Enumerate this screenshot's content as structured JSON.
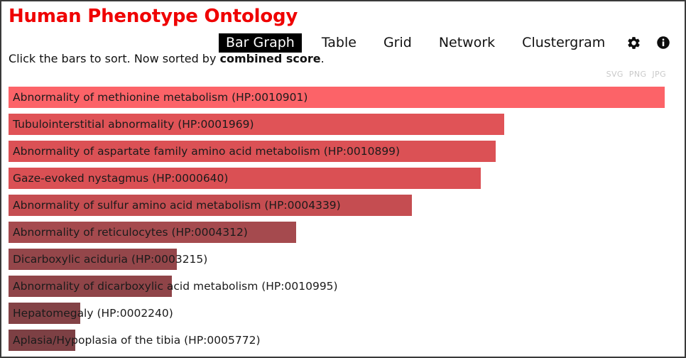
{
  "header": {
    "title": "Human Phenotype Ontology",
    "title_color": "#ef0000",
    "subtitle_pre": "Click the bars to sort. Now sorted by ",
    "subtitle_bold": "combined score",
    "subtitle_post": "."
  },
  "tabs": [
    {
      "label": "Bar Graph",
      "active": true
    },
    {
      "label": "Table",
      "active": false
    },
    {
      "label": "Grid",
      "active": false
    },
    {
      "label": "Network",
      "active": false
    },
    {
      "label": "Clustergram",
      "active": false
    }
  ],
  "header_icons": [
    {
      "name": "gear-icon",
      "label": "Settings"
    },
    {
      "name": "info-icon",
      "label": "Info"
    }
  ],
  "exports": [
    "SVG",
    "PNG",
    "JPG"
  ],
  "chart_data": {
    "type": "bar",
    "orientation": "horizontal",
    "title": "Human Phenotype Ontology",
    "xlabel": "",
    "ylabel": "",
    "sorted_by": "combined score",
    "grid": false,
    "legend": false,
    "xlim": [
      0,
      100
    ],
    "categories": [
      "Abnormality of methionine metabolism (HP:0010901)",
      "Tubulointerstitial abnormality (HP:0001969)",
      "Abnormality of aspartate family amino acid metabolism (HP:0010899)",
      "Gaze-evoked nystagmus (HP:0000640)",
      "Abnormality of sulfur amino acid metabolism (HP:0004339)",
      "Abnormality of reticulocytes (HP:0004312)",
      "Dicarboxylic aciduria (HP:0003215)",
      "Abnormality of dicarboxylic acid metabolism (HP:0010995)",
      "Hepatomegaly (HP:0002240)",
      "Aplasia/Hypoplasia of the tibia (HP:0005772)"
    ],
    "values": [
      100.0,
      75.5,
      74.2,
      72.0,
      61.5,
      43.8,
      25.6,
      24.9,
      10.9,
      10.2
    ],
    "bar_colors": [
      "#fc6368",
      "#e05357",
      "#db5155",
      "#da5054",
      "#c54d51",
      "#a54a4e",
      "#94464a",
      "#8f4448",
      "#834246",
      "#7d4044"
    ]
  }
}
